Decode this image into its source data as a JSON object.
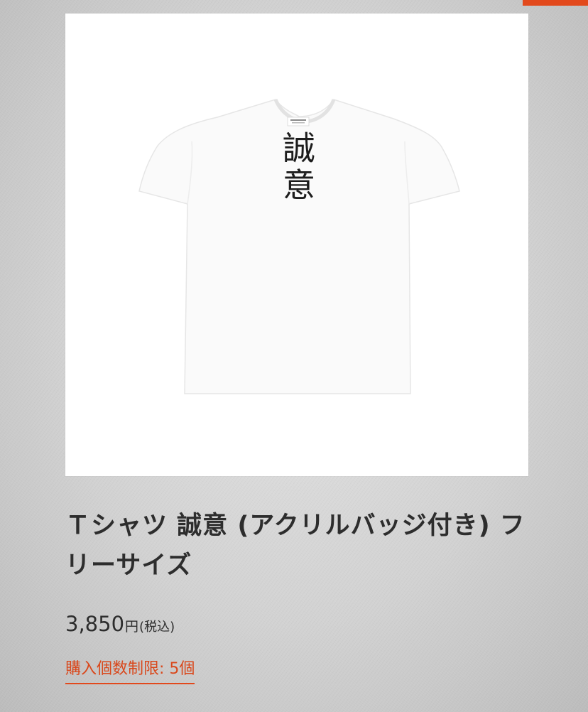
{
  "product": {
    "title": "Ｔシャツ 誠意 (アクリルバッジ付き) フリーサイズ",
    "print_text": "誠意",
    "price": {
      "value": "3,850",
      "unit": "円",
      "tax_note": "(税込)"
    },
    "purchase_limit": "購入個数制限: 5個"
  },
  "colors": {
    "accent": "#e2491c",
    "shirt": "#fafafa",
    "background": "#d4d4d4"
  }
}
